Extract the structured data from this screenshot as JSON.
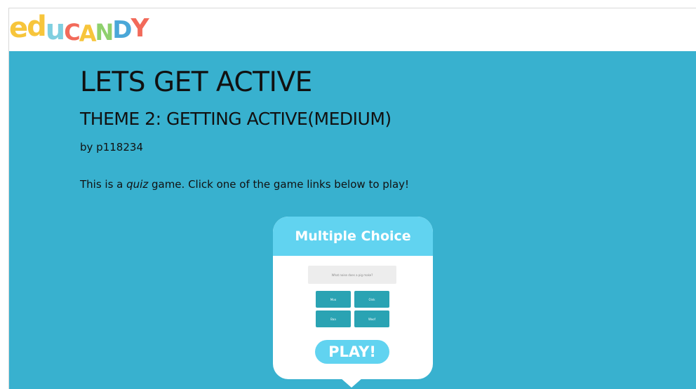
{
  "logo": {
    "letters": [
      "e",
      "d",
      "u",
      "C",
      "A",
      "N",
      "D",
      "Y"
    ]
  },
  "game": {
    "title": "LETS GET ACTIVE",
    "subtitle": "THEME 2: GETTING ACTIVE(MEDIUM)",
    "by_prefix": "by ",
    "author": "p118234",
    "desc_before": "This is a ",
    "desc_type": "quiz",
    "desc_after": " game. Click one of the game links below to play!"
  },
  "card": {
    "header": "Multiple Choice",
    "preview_question": "What noise does a pig make?",
    "preview_answers": [
      "Moo",
      "Oink",
      "Baa",
      "Woof"
    ],
    "play_label": "PLAY!"
  },
  "colors": {
    "background": "#38b1cf",
    "card_header": "#61d3f0",
    "answer_tile": "#2aa3b3"
  }
}
